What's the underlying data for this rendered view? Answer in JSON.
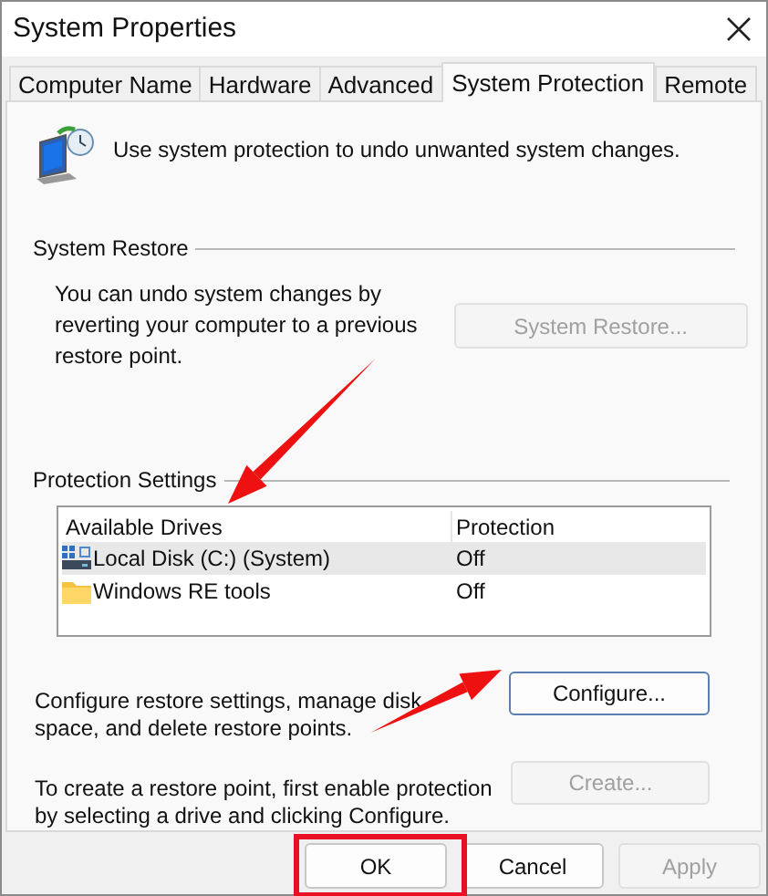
{
  "window": {
    "title": "System Properties"
  },
  "tabs": [
    {
      "label": "Computer Name",
      "selected": false
    },
    {
      "label": "Hardware",
      "selected": false
    },
    {
      "label": "Advanced",
      "selected": false
    },
    {
      "label": "System Protection",
      "selected": true
    },
    {
      "label": "Remote",
      "selected": false
    }
  ],
  "intro": "Use system protection to undo unwanted system changes.",
  "system_restore": {
    "title": "System Restore",
    "text": "You can undo system changes by reverting your computer to a previous restore point.",
    "button": {
      "label": "System Restore...",
      "disabled": true
    }
  },
  "protection_settings": {
    "title": "Protection Settings",
    "columns": [
      "Available Drives",
      "Protection"
    ],
    "rows": [
      {
        "kind": "disk",
        "drive": "Local Disk (C:) (System)",
        "protection": "Off",
        "selected": true
      },
      {
        "kind": "folder",
        "drive": "Windows RE tools",
        "protection": "Off",
        "selected": false
      }
    ],
    "configure_text": "Configure restore settings, manage disk space, and delete restore points.",
    "configure_button": {
      "label": "Configure...",
      "disabled": false
    },
    "create_text": "To create a restore point, first enable protection by selecting a drive and clicking Configure.",
    "create_button": {
      "label": "Create...",
      "disabled": true
    }
  },
  "buttons": [
    {
      "label": "OK",
      "disabled": false
    },
    {
      "label": "Cancel",
      "disabled": false
    },
    {
      "label": "Apply",
      "disabled": true
    }
  ],
  "annotations": [
    {
      "kind": "arrow"
    },
    {
      "kind": "arrow"
    },
    {
      "kind": "frame"
    }
  ]
}
